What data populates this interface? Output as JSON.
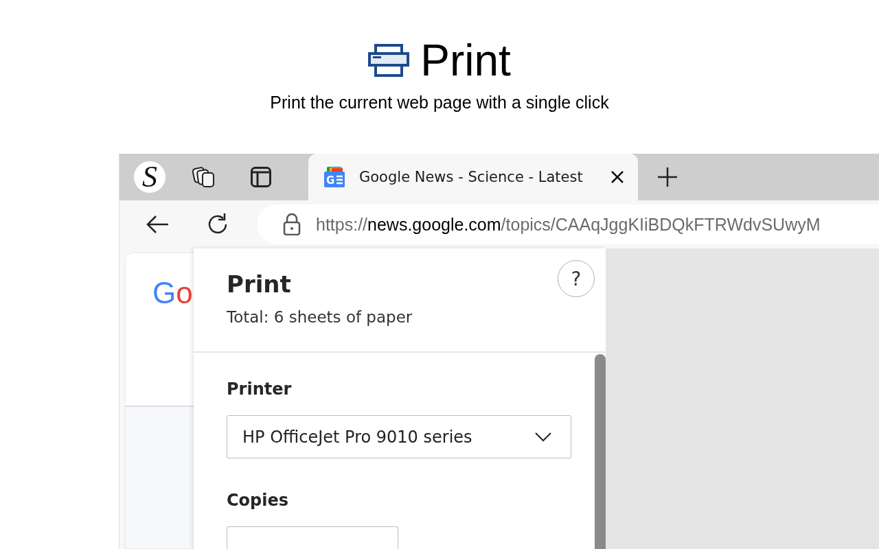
{
  "header": {
    "title": "Print",
    "subtitle": "Print the current web page with a single click"
  },
  "browser": {
    "profile_initial": "S",
    "tabs": [
      {
        "favicon_letter": "G",
        "title": "Google News - Science - Latest",
        "selected": true
      }
    ],
    "address": {
      "scheme": "https://",
      "host": "news.google.com",
      "path": "/topics/CAAqJggKIiBDQkFTRWdvSUwyM"
    },
    "page_logo": "Go"
  },
  "print_dialog": {
    "title": "Print",
    "total": "Total: 6 sheets of paper",
    "help": "?",
    "fields": [
      {
        "label": "Printer",
        "kind": "select",
        "value": "HP OfficeJet Pro 9010 series"
      },
      {
        "label": "Copies",
        "kind": "number"
      }
    ]
  }
}
